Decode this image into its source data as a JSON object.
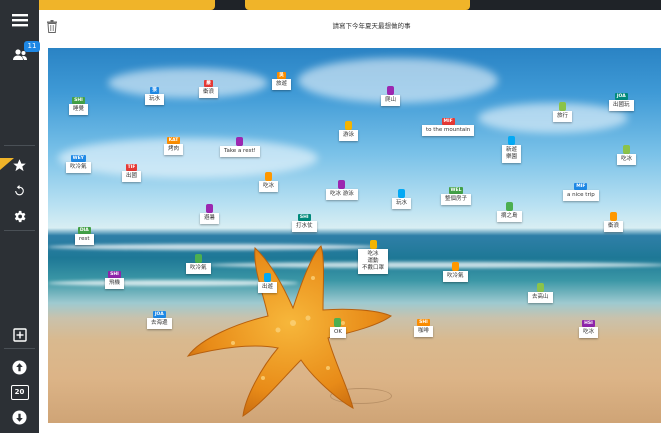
{
  "sidebar": {
    "participants_badge": "11",
    "page_counter": "20",
    "icons": [
      "menu-icon",
      "users-icon",
      "star-icon",
      "refresh-icon",
      "gear-icon",
      "add-icon",
      "arrow-up-icon",
      "arrow-down-icon"
    ]
  },
  "main": {
    "title": "請寫下今年夏天最想做的事"
  },
  "notes": [
    {
      "tag": "SHI",
      "text": "睡覺"
    },
    {
      "tag": "張",
      "text": "玩水"
    },
    {
      "tag": "嚴",
      "text": "衝浪"
    },
    {
      "tag": "吳",
      "text": "旅遊"
    },
    {
      "tag": "",
      "text": "爬山"
    },
    {
      "tag": "JOA",
      "text": "出國玩"
    },
    {
      "tag": "",
      "text": "旅行"
    },
    {
      "tag": "",
      "text": "游泳"
    },
    {
      "tag": "MIF",
      "text": "to the mountain"
    },
    {
      "tag": "KAT",
      "text": "烤肉"
    },
    {
      "tag": "",
      "text": "Take a rest!"
    },
    {
      "tag": "",
      "text": "新遊\n樂園"
    },
    {
      "tag": "",
      "text": "吃冰"
    },
    {
      "tag": "WEY",
      "text": "吹冷氣"
    },
    {
      "tag": "TIF",
      "text": "出國"
    },
    {
      "tag": "",
      "text": "吃冰"
    },
    {
      "tag": "",
      "text": "吃冰 游泳"
    },
    {
      "tag": "",
      "text": "玩水"
    },
    {
      "tag": "WEL",
      "text": "整個房子"
    },
    {
      "tag": "MIF",
      "text": "a nice trip"
    },
    {
      "tag": "",
      "text": "摘之島"
    },
    {
      "tag": "",
      "text": "衝浪"
    },
    {
      "tag": "",
      "text": "避暑"
    },
    {
      "tag": "SHI",
      "text": "打水仗"
    },
    {
      "tag": "DIA",
      "text": "rest"
    },
    {
      "tag": "",
      "text": "吃冰\n運動\n不戴口罩"
    },
    {
      "tag": "",
      "text": "吹冷氣"
    },
    {
      "tag": "",
      "text": "吹冷氣"
    },
    {
      "tag": "SHI",
      "text": "飛機"
    },
    {
      "tag": "",
      "text": "出遊"
    },
    {
      "tag": "",
      "text": "去高山"
    },
    {
      "tag": "JOA",
      "text": "去海邊"
    },
    {
      "tag": "",
      "text": "OK"
    },
    {
      "tag": "SHI",
      "text": "咖啡"
    },
    {
      "tag": "HSI",
      "text": "吃冰"
    }
  ],
  "colors": {
    "sidebar": "#2c3035",
    "accent": "#f0b429",
    "badge": "#1e88e5"
  }
}
